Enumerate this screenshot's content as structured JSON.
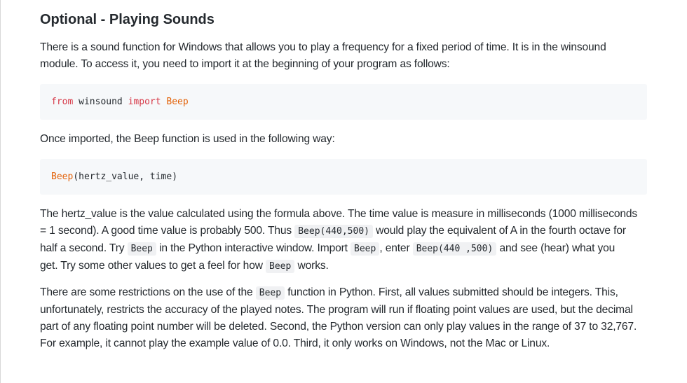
{
  "heading": "Optional - Playing Sounds",
  "p1": {
    "line1": "There is a sound function for Windows that allows you to play a frequency for a fixed period of time. It is in the winsound",
    "line2": "module. To access it, you need to import it at the beginning of your program as follows:"
  },
  "code1": {
    "kw_from": "from",
    "module": "winsound",
    "kw_import": "import",
    "name": "Beep"
  },
  "p2": "Once imported, the Beep function is used in the following way:",
  "code2": {
    "fn": "Beep",
    "args": "(hertz_value, time)"
  },
  "p3": {
    "line1": "The hertz_value is the value calculated using the formula above. The time value is measure in milliseconds (1000 milliseconds",
    "line2_a": "= 1 second). A good time value is probably 500. Thus",
    "code_a": "Beep(440,500)",
    "line2_b": "would play the equivalent of A in the fourth octave for",
    "line3_a": "half a second. Try",
    "code_b": "Beep",
    "line3_b": "in the Python interactive window. Import",
    "code_c": "Beep",
    "line3_c": ", enter",
    "code_d": "Beep(440 ,500)",
    "line3_d": "and see (hear) what you",
    "line4_a": "get. Try some other values to get a feel for how",
    "code_e": "Beep",
    "line4_b": "works."
  },
  "p4": {
    "line1_a": "There are some restrictions on the use of the",
    "code_a": "Beep",
    "line1_b": "function in Python. First, all values submitted should be integers. This,",
    "line2": "unfortunately, restricts the accuracy of the played notes. The program will run if floating point values are used, but the decimal",
    "line3": "part of any floating point number will be deleted. Second, the Python version can only play values in the range of 37 to 32,767.",
    "line4": "For example, it cannot play the example value of 0.0. Third, it only works on Windows, not the Mac or Linux."
  }
}
